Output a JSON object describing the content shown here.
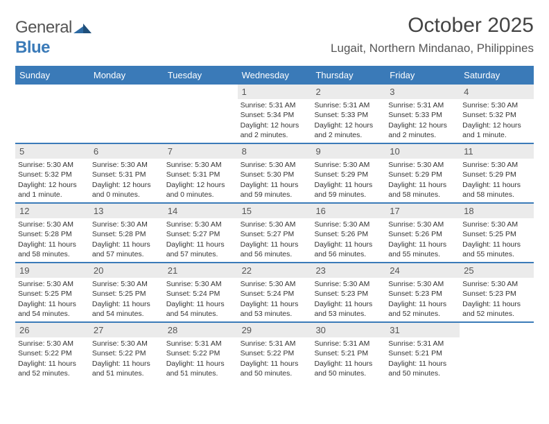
{
  "logo": {
    "word1": "General",
    "word2": "Blue"
  },
  "title": "October 2025",
  "location": "Lugait, Northern Mindanao, Philippines",
  "dayNames": [
    "Sunday",
    "Monday",
    "Tuesday",
    "Wednesday",
    "Thursday",
    "Friday",
    "Saturday"
  ],
  "labels": {
    "sunrise": "Sunrise: ",
    "sunset": "Sunset: ",
    "daylight": "Daylight: "
  },
  "weeks": [
    [
      {
        "empty": true
      },
      {
        "empty": true
      },
      {
        "empty": true
      },
      {
        "n": "1",
        "sunrise": "5:31 AM",
        "sunset": "5:34 PM",
        "daylight": "12 hours and 2 minutes."
      },
      {
        "n": "2",
        "sunrise": "5:31 AM",
        "sunset": "5:33 PM",
        "daylight": "12 hours and 2 minutes."
      },
      {
        "n": "3",
        "sunrise": "5:31 AM",
        "sunset": "5:33 PM",
        "daylight": "12 hours and 2 minutes."
      },
      {
        "n": "4",
        "sunrise": "5:30 AM",
        "sunset": "5:32 PM",
        "daylight": "12 hours and 1 minute."
      }
    ],
    [
      {
        "n": "5",
        "sunrise": "5:30 AM",
        "sunset": "5:32 PM",
        "daylight": "12 hours and 1 minute."
      },
      {
        "n": "6",
        "sunrise": "5:30 AM",
        "sunset": "5:31 PM",
        "daylight": "12 hours and 0 minutes."
      },
      {
        "n": "7",
        "sunrise": "5:30 AM",
        "sunset": "5:31 PM",
        "daylight": "12 hours and 0 minutes."
      },
      {
        "n": "8",
        "sunrise": "5:30 AM",
        "sunset": "5:30 PM",
        "daylight": "11 hours and 59 minutes."
      },
      {
        "n": "9",
        "sunrise": "5:30 AM",
        "sunset": "5:29 PM",
        "daylight": "11 hours and 59 minutes."
      },
      {
        "n": "10",
        "sunrise": "5:30 AM",
        "sunset": "5:29 PM",
        "daylight": "11 hours and 58 minutes."
      },
      {
        "n": "11",
        "sunrise": "5:30 AM",
        "sunset": "5:29 PM",
        "daylight": "11 hours and 58 minutes."
      }
    ],
    [
      {
        "n": "12",
        "sunrise": "5:30 AM",
        "sunset": "5:28 PM",
        "daylight": "11 hours and 58 minutes."
      },
      {
        "n": "13",
        "sunrise": "5:30 AM",
        "sunset": "5:28 PM",
        "daylight": "11 hours and 57 minutes."
      },
      {
        "n": "14",
        "sunrise": "5:30 AM",
        "sunset": "5:27 PM",
        "daylight": "11 hours and 57 minutes."
      },
      {
        "n": "15",
        "sunrise": "5:30 AM",
        "sunset": "5:27 PM",
        "daylight": "11 hours and 56 minutes."
      },
      {
        "n": "16",
        "sunrise": "5:30 AM",
        "sunset": "5:26 PM",
        "daylight": "11 hours and 56 minutes."
      },
      {
        "n": "17",
        "sunrise": "5:30 AM",
        "sunset": "5:26 PM",
        "daylight": "11 hours and 55 minutes."
      },
      {
        "n": "18",
        "sunrise": "5:30 AM",
        "sunset": "5:25 PM",
        "daylight": "11 hours and 55 minutes."
      }
    ],
    [
      {
        "n": "19",
        "sunrise": "5:30 AM",
        "sunset": "5:25 PM",
        "daylight": "11 hours and 54 minutes."
      },
      {
        "n": "20",
        "sunrise": "5:30 AM",
        "sunset": "5:25 PM",
        "daylight": "11 hours and 54 minutes."
      },
      {
        "n": "21",
        "sunrise": "5:30 AM",
        "sunset": "5:24 PM",
        "daylight": "11 hours and 54 minutes."
      },
      {
        "n": "22",
        "sunrise": "5:30 AM",
        "sunset": "5:24 PM",
        "daylight": "11 hours and 53 minutes."
      },
      {
        "n": "23",
        "sunrise": "5:30 AM",
        "sunset": "5:23 PM",
        "daylight": "11 hours and 53 minutes."
      },
      {
        "n": "24",
        "sunrise": "5:30 AM",
        "sunset": "5:23 PM",
        "daylight": "11 hours and 52 minutes."
      },
      {
        "n": "25",
        "sunrise": "5:30 AM",
        "sunset": "5:23 PM",
        "daylight": "11 hours and 52 minutes."
      }
    ],
    [
      {
        "n": "26",
        "sunrise": "5:30 AM",
        "sunset": "5:22 PM",
        "daylight": "11 hours and 52 minutes."
      },
      {
        "n": "27",
        "sunrise": "5:30 AM",
        "sunset": "5:22 PM",
        "daylight": "11 hours and 51 minutes."
      },
      {
        "n": "28",
        "sunrise": "5:31 AM",
        "sunset": "5:22 PM",
        "daylight": "11 hours and 51 minutes."
      },
      {
        "n": "29",
        "sunrise": "5:31 AM",
        "sunset": "5:22 PM",
        "daylight": "11 hours and 50 minutes."
      },
      {
        "n": "30",
        "sunrise": "5:31 AM",
        "sunset": "5:21 PM",
        "daylight": "11 hours and 50 minutes."
      },
      {
        "n": "31",
        "sunrise": "5:31 AM",
        "sunset": "5:21 PM",
        "daylight": "11 hours and 50 minutes."
      },
      {
        "empty": true
      }
    ]
  ]
}
